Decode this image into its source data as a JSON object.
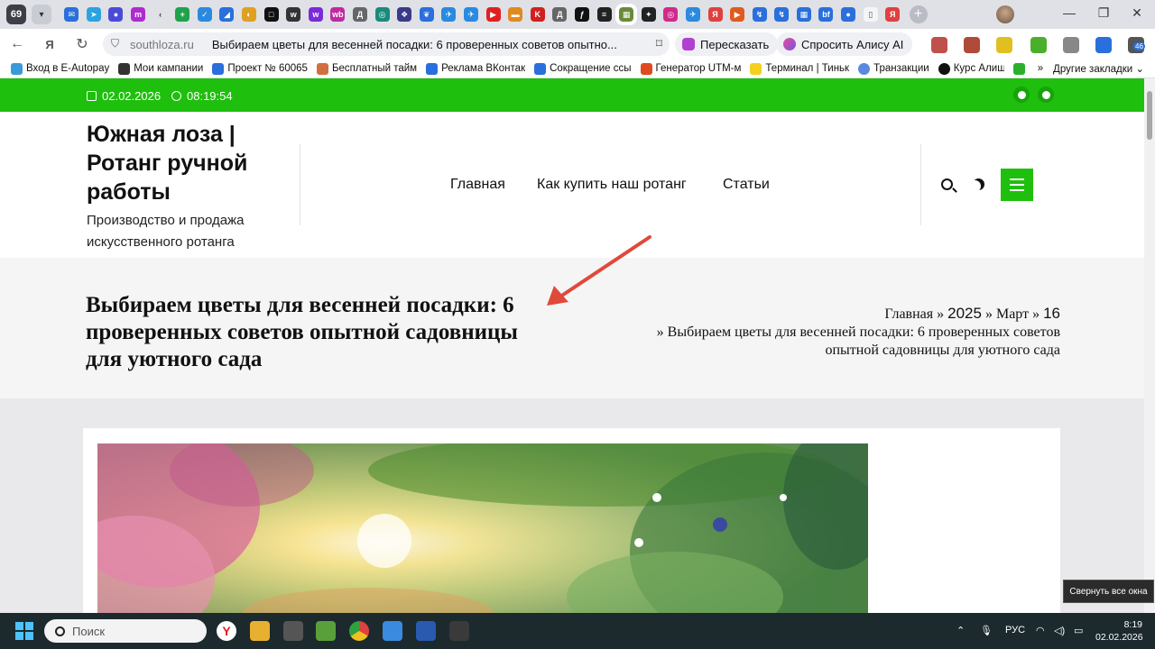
{
  "browser": {
    "tab_count": "69",
    "address": {
      "domain": "southloza.ru",
      "page_title": "Выбираем цветы для весенней посадки: 6 проверенных советов опытно..."
    },
    "retell_label": "Пересказать",
    "ask_alice_label": "Спросить Алису AI",
    "ext_badge": "46",
    "bookmarks": [
      "Вход в E-Autopay",
      "Мои кампании",
      "Проект № 60065",
      "Бесплатный тайм",
      "Реклама ВКонтак",
      "Сокращение ссы",
      "Генератор UTM-м",
      "Терминал | Тиньк",
      "Транзакции",
      "Курс Алиш"
    ],
    "bookmarks_more": "»",
    "other_bookmarks": "Другие закладки"
  },
  "site": {
    "topbar": {
      "date": "02.02.2026",
      "time": "08:19:54"
    },
    "title": "Южная лоза | Ротанг ручной работы",
    "description": "Производство и продажа искусственного ротанга",
    "menu": [
      "Главная",
      "Как купить наш ротанг",
      "Статьи"
    ]
  },
  "hero": {
    "title": "Выбираем цветы для весенней посадки: 6 проверенных советов опытной садовницы для уютного сада",
    "breadcrumb": {
      "home": "Главная",
      "year": "2025",
      "month": "Март",
      "day": "16",
      "sep": "»",
      "current": "Выбираем цветы для весенней посадки: 6 проверенных советов опытной садовницы для уютного сада"
    }
  },
  "tooltip": "Свернуть все окна",
  "taskbar": {
    "search_placeholder": "Поиск",
    "language": "РУС",
    "time": "8:19",
    "date": "02.02.2026"
  },
  "colors": {
    "accent_green": "#1fbf0d",
    "annotation_arrow": "#e04a3a"
  }
}
